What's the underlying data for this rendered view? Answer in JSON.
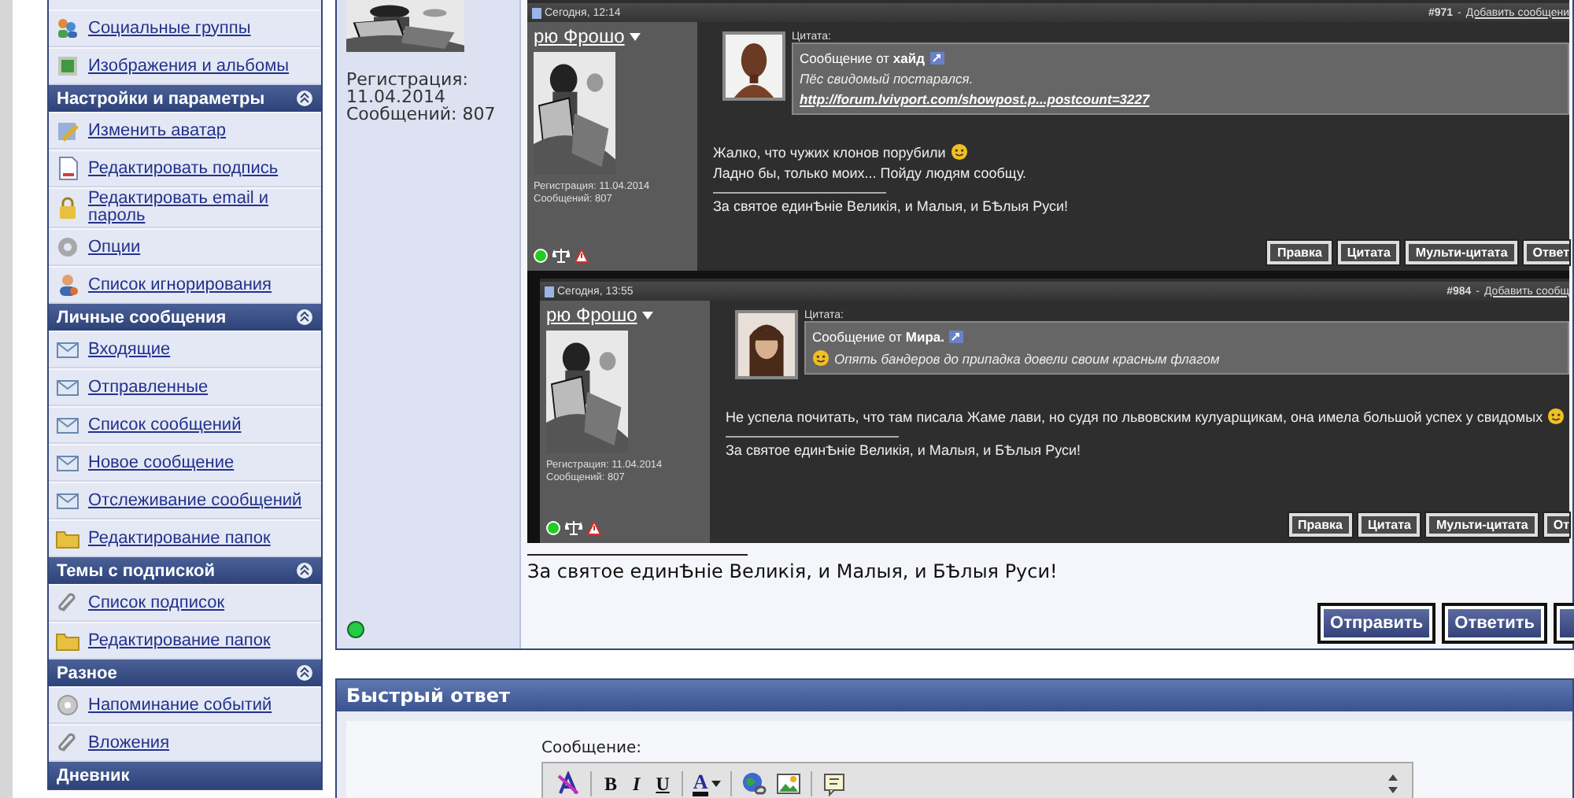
{
  "sidebar": [
    {
      "kind": "link",
      "label": "Социальные группы"
    },
    {
      "kind": "link",
      "label": "Изображения и альбомы"
    },
    {
      "kind": "header",
      "label": "Настройки и параметры"
    },
    {
      "kind": "link",
      "label": "Изменить аватар"
    },
    {
      "kind": "link",
      "label": "Редактировать подпись"
    },
    {
      "kind": "link",
      "label": "Редактировать email и пароль"
    },
    {
      "kind": "link",
      "label": "Опции"
    },
    {
      "kind": "link",
      "label": "Список игнорирования"
    },
    {
      "kind": "header",
      "label": "Личные сообщения"
    },
    {
      "kind": "link",
      "label": "Входящие"
    },
    {
      "kind": "link",
      "label": "Отправленные"
    },
    {
      "kind": "link",
      "label": "Список сообщений"
    },
    {
      "kind": "link",
      "label": "Новое сообщение"
    },
    {
      "kind": "link",
      "label": "Отслеживание сообщений"
    },
    {
      "kind": "link",
      "label": "Редактирование папок"
    },
    {
      "kind": "header",
      "label": "Темы с подпиской"
    },
    {
      "kind": "link",
      "label": "Список подписок"
    },
    {
      "kind": "link",
      "label": "Редактирование папок"
    },
    {
      "kind": "header",
      "label": "Разное"
    },
    {
      "kind": "link",
      "label": "Напоминание событий"
    },
    {
      "kind": "link",
      "label": "Вложения"
    },
    {
      "kind": "header",
      "label": "Дневник",
      "collapsible": false
    }
  ],
  "profile": {
    "registration_label": "Регистрация:",
    "registration_date": "11.04.2014",
    "posts": "Сообщений: 807",
    "online": true
  },
  "embedded_posts": [
    {
      "date": "Сегодня, 12:14",
      "number": "#971",
      "separator": "-",
      "add_link": "Добавить сообщени",
      "username": "рю Фрошо",
      "registration": "Регистрация: 11.04.2014",
      "count": "Сообщений: 807",
      "quote_label": "Цитата:",
      "quote_from": "Сообщение от **хайд**",
      "quote_smiley": false,
      "quote_text": "Пёс свидомый постарался.",
      "quote_link": "http://forum.lvivport.com/showpost.p...postcount=3227",
      "body": [
        {
          "text": "Жалко, что чужих клонов порубили",
          "smiley": true
        },
        {
          "text": "Ладно бы, только моих... Пойду людям сообщу.",
          "smiley": false
        }
      ],
      "signature": "За святое единѢніе Великія, и Малыя, и БѢлыя Руси!",
      "buttons": [
        "Правка",
        "Цитата",
        "Мульти-цитата",
        "Ответ"
      ]
    },
    {
      "date": "Сегодня, 13:55",
      "number": "#984",
      "separator": "-",
      "add_link": "Добавить сообщ",
      "username": "рю Фрошо",
      "registration": "Регистрация: 11.04.2014",
      "count": "Сообщений: 807",
      "quote_label": "Цитата:",
      "quote_from": "Сообщение от **Мира.**",
      "quote_smiley": true,
      "quote_text": "Опять бандеров до припадка довели своим красным флагом",
      "body": [
        {
          "text": "Не успела почитать, что там писала Жаме лави, но судя по львовским кулуарщикам, она имела большой успех у свидомых",
          "smiley": true
        }
      ],
      "signature": "За святое единѢніе Великія, и Малыя, и БѢлыя Руси!",
      "buttons": [
        "Правка",
        "Цитата",
        "Мульти-цитата",
        "От"
      ]
    }
  ],
  "signature": "За святое единѢніе Великія, и Малыя, и БѢлыя Руси!",
  "post_buttons": [
    "Отправить",
    "Ответить"
  ],
  "quick_reply": {
    "title": "Быстрый ответ",
    "message_label": "Сообщение:",
    "format_buttons": [
      "B",
      "I",
      "U"
    ],
    "color_button": "A"
  }
}
